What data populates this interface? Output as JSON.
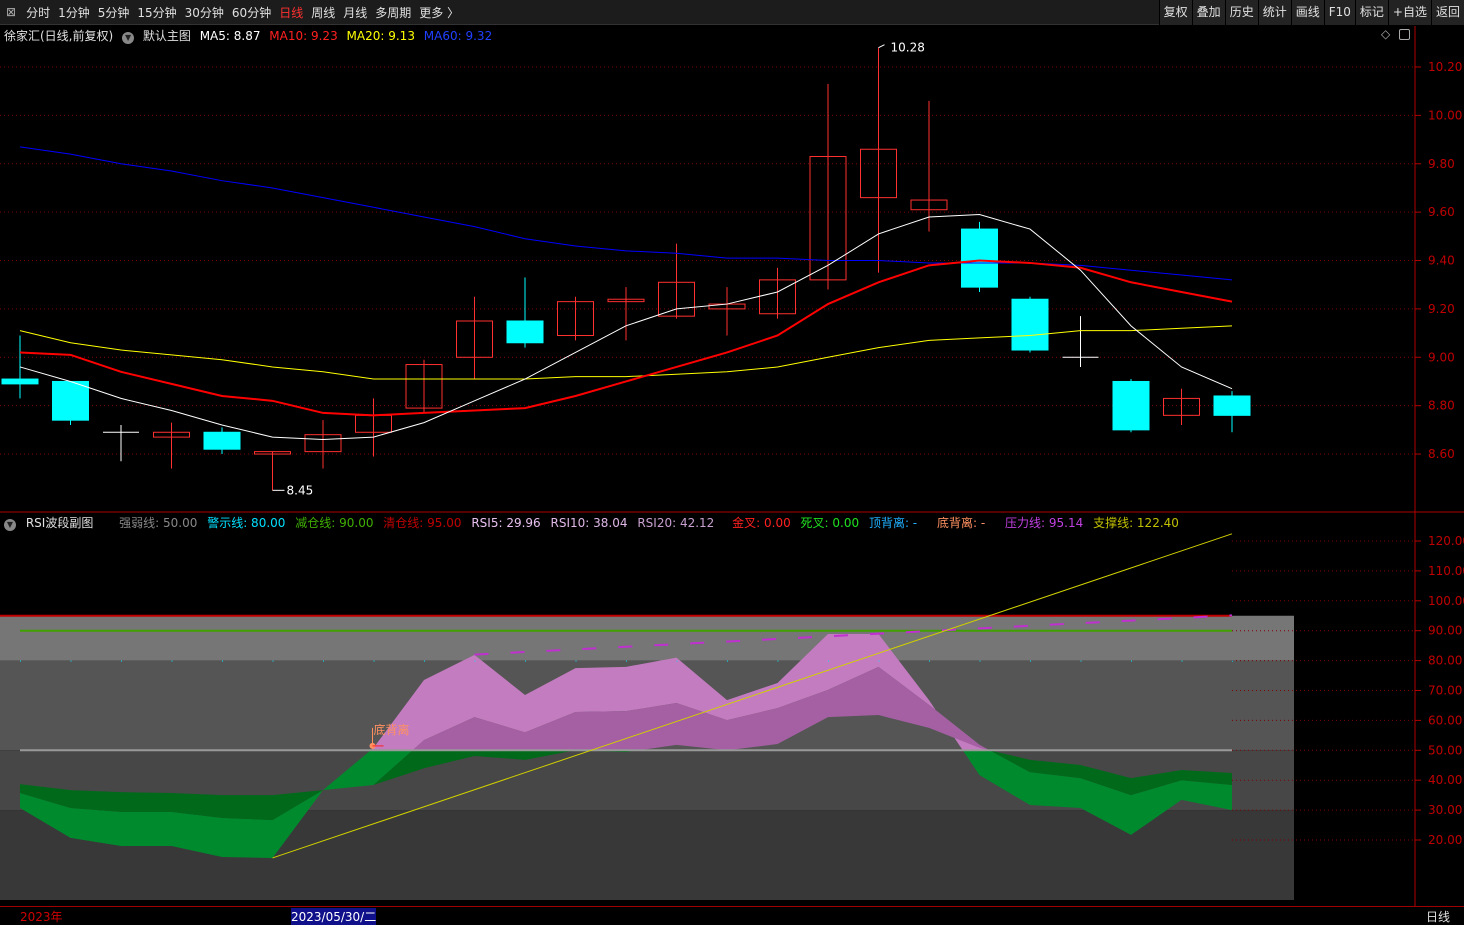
{
  "toolbar": {
    "tabs": [
      "分时",
      "1分钟",
      "5分钟",
      "15分钟",
      "30分钟",
      "60分钟",
      "日线",
      "周线",
      "月线",
      "多周期",
      "更多 〉"
    ],
    "active_tab": "日线",
    "right_buttons": [
      "复权",
      "叠加",
      "历史",
      "统计",
      "画线",
      "F10",
      "标记",
      "+自选",
      "返回"
    ]
  },
  "main": {
    "title": "徐家汇(日线,前复权)",
    "indicator": "默认主图",
    "ma5": "MA5: 8.87",
    "ma10": "MA10: 9.23",
    "ma20": "MA20: 9.13",
    "ma60": "MA60: 9.32",
    "high_label": "10.28",
    "low_label": "8.45",
    "y_ticks": [
      "10.20",
      "10.00",
      "9.80",
      "9.60",
      "9.40",
      "9.20",
      "9.00",
      "8.80",
      "8.60"
    ]
  },
  "colors": {
    "up": "#ff3030",
    "down": "#00ffff",
    "ma5": "#ffffff",
    "ma10": "#ff0000",
    "ma20": "#ffff00",
    "ma60": "#0000ff"
  },
  "chart_data": {
    "type": "candlestick",
    "ylim": [
      8.4,
      10.4
    ],
    "candles": [
      [
        8.91,
        8.89,
        9.09,
        8.83
      ],
      [
        8.9,
        8.74,
        8.9,
        8.72
      ],
      [
        8.69,
        8.69,
        8.72,
        8.57
      ],
      [
        8.67,
        8.69,
        8.73,
        8.54
      ],
      [
        8.69,
        8.62,
        8.71,
        8.6
      ],
      [
        8.6,
        8.61,
        8.61,
        8.45
      ],
      [
        8.61,
        8.68,
        8.74,
        8.54
      ],
      [
        8.69,
        8.76,
        8.83,
        8.59
      ],
      [
        8.79,
        8.97,
        8.99,
        8.77
      ],
      [
        9.0,
        9.15,
        9.25,
        8.91
      ],
      [
        9.15,
        9.06,
        9.33,
        9.04
      ],
      [
        9.09,
        9.23,
        9.25,
        9.07
      ],
      [
        9.23,
        9.24,
        9.29,
        9.07
      ],
      [
        9.17,
        9.31,
        9.47,
        9.16
      ],
      [
        9.2,
        9.22,
        9.29,
        9.09
      ],
      [
        9.18,
        9.32,
        9.37,
        9.16
      ],
      [
        9.32,
        9.83,
        10.13,
        9.28
      ],
      [
        9.66,
        9.86,
        10.28,
        9.35
      ],
      [
        9.61,
        9.65,
        10.06,
        9.52
      ],
      [
        9.53,
        9.29,
        9.56,
        9.27
      ],
      [
        9.24,
        9.03,
        9.25,
        9.02
      ],
      [
        9.0,
        9.0,
        9.17,
        8.96
      ],
      [
        8.9,
        8.7,
        8.91,
        8.69
      ],
      [
        8.76,
        8.83,
        8.87,
        8.72
      ],
      [
        8.84,
        8.76,
        8.86,
        8.69
      ]
    ],
    "ma5": [
      8.96,
      8.9,
      8.83,
      8.78,
      8.72,
      8.67,
      8.66,
      8.67,
      8.73,
      8.82,
      8.91,
      9.02,
      9.13,
      9.2,
      9.22,
      9.27,
      9.38,
      9.51,
      9.58,
      9.59,
      9.53,
      9.36,
      9.13,
      8.96,
      8.87
    ],
    "ma10": [
      9.02,
      9.01,
      8.94,
      8.89,
      8.84,
      8.82,
      8.77,
      8.76,
      8.77,
      8.78,
      8.79,
      8.84,
      8.9,
      8.96,
      9.02,
      9.09,
      9.22,
      9.31,
      9.38,
      9.4,
      9.39,
      9.37,
      9.31,
      9.27,
      9.23
    ],
    "ma20": [
      9.11,
      9.06,
      9.03,
      9.01,
      8.99,
      8.96,
      8.94,
      8.91,
      8.91,
      8.91,
      8.91,
      8.92,
      8.92,
      8.93,
      8.94,
      8.96,
      9.0,
      9.04,
      9.07,
      9.08,
      9.09,
      9.11,
      9.11,
      9.12,
      9.13
    ],
    "ma60": [
      9.87,
      9.84,
      9.8,
      9.77,
      9.73,
      9.7,
      9.66,
      9.62,
      9.58,
      9.54,
      9.49,
      9.46,
      9.44,
      9.43,
      9.41,
      9.41,
      9.4,
      9.4,
      9.39,
      9.39,
      9.39,
      9.38,
      9.36,
      9.34,
      9.32
    ],
    "rsi": {
      "ylim": [
        0,
        125
      ],
      "y_ticks": [
        "120.00",
        "110.00",
        "100.00",
        "90.00",
        "80.00",
        "70.00",
        "60.00",
        "50.00",
        "40.00",
        "30.00",
        "20.00"
      ],
      "rsi5": [
        30.7,
        20.7,
        18,
        18,
        14.3,
        14,
        36.7,
        50.8,
        73.5,
        81.9,
        68.5,
        77.5,
        77.9,
        81,
        66.8,
        72.5,
        88.9,
        88.9,
        66.8,
        41.7,
        31.7,
        30.7,
        21.7,
        33.4,
        30
      ],
      "rsi10": [
        35.7,
        30.7,
        29.4,
        29.4,
        27.4,
        26.7,
        36.7,
        38.4,
        53.4,
        61.1,
        56,
        62.8,
        63.1,
        65.8,
        60.1,
        64.1,
        70.2,
        77.9,
        65.2,
        51.8,
        42.7,
        40.7,
        35,
        40,
        38.4
      ],
      "rsi20": [
        38.7,
        36.7,
        36,
        35.7,
        35,
        35,
        36.7,
        38.4,
        44,
        48.1,
        46.8,
        50,
        49.4,
        51.8,
        50,
        52.1,
        61.1,
        61.8,
        57.5,
        50.8,
        46.8,
        45.1,
        40.7,
        43.4,
        42.4
      ],
      "pressure_line": [
        82,
        95.14
      ],
      "support_line": [
        14,
        122.4
      ]
    }
  },
  "rsi_panel": {
    "title": "RSI波段副图",
    "strong": "强弱线: 50.00",
    "warn": "警示线: 80.00",
    "reduce": "减仓线: 90.00",
    "clear": "清仓线: 95.00",
    "rsi5": "RSI5: 29.96",
    "rsi10": "RSI10: 38.04",
    "rsi20": "RSI20: 42.12",
    "golden": "金叉: 0.00",
    "dead": "死叉: 0.00",
    "top_div": "顶背离: -",
    "bottom_div": "底背离: -",
    "pressure": "压力线: 95.14",
    "support": "支撑线: 122.40",
    "marker": "底背离"
  },
  "bottom": {
    "year": "2023年",
    "cursor_date": "2023/05/30/二",
    "period": "日线"
  }
}
